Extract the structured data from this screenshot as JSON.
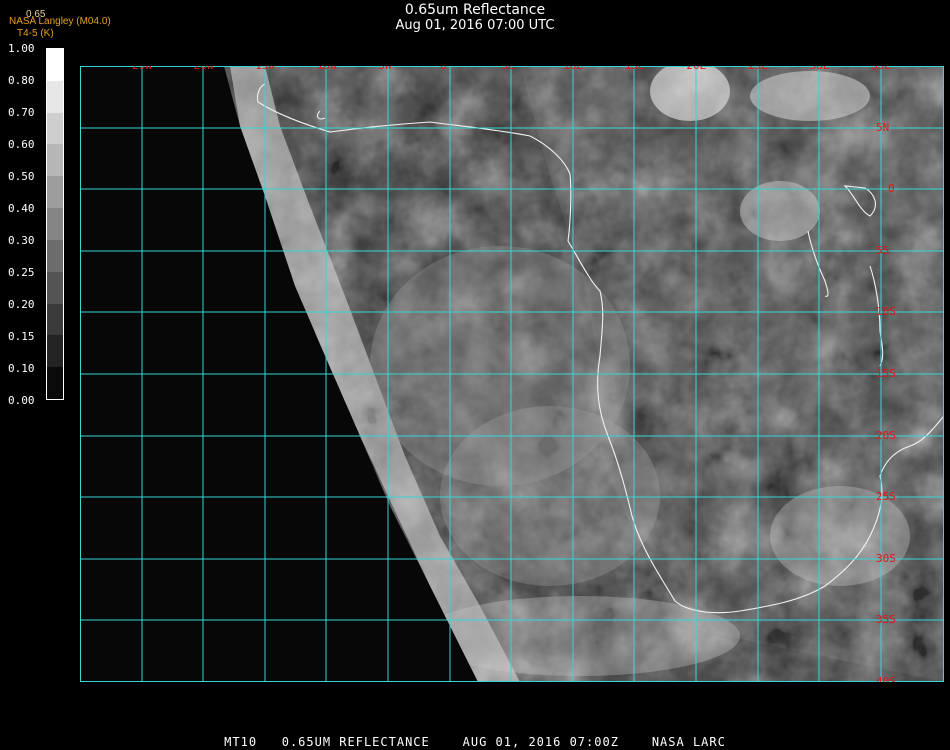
{
  "header": {
    "title": "0.65um Reflectance",
    "datetime": "Aug 01, 2016 07:00 UTC"
  },
  "brand": {
    "line_top": "0.65",
    "line1": "NASA Langley (M04.0)",
    "line2": "T4-5 (K)"
  },
  "colorbar": {
    "ticks": [
      "1.00",
      "0.80",
      "0.70",
      "0.60",
      "0.50",
      "0.40",
      "0.30",
      "0.25",
      "0.20",
      "0.15",
      "0.10",
      "0.00"
    ]
  },
  "map": {
    "lon_labels": [
      "25W",
      "20W",
      "15W",
      "10W",
      "5W",
      "0",
      "5E",
      "10E",
      "15E",
      "20E",
      "25E",
      "30E",
      "35E"
    ],
    "lat_labels": [
      "5N",
      "0",
      "5S",
      "10S",
      "15S",
      "20S",
      "25S",
      "30S",
      "35S",
      "40S"
    ],
    "grid_color": "#35d6d6",
    "label_color": "#e01818"
  },
  "footer": {
    "text": "MT10   0.65UM REFLECTANCE    AUG 01, 2016 07:00Z    NASA LARC"
  }
}
